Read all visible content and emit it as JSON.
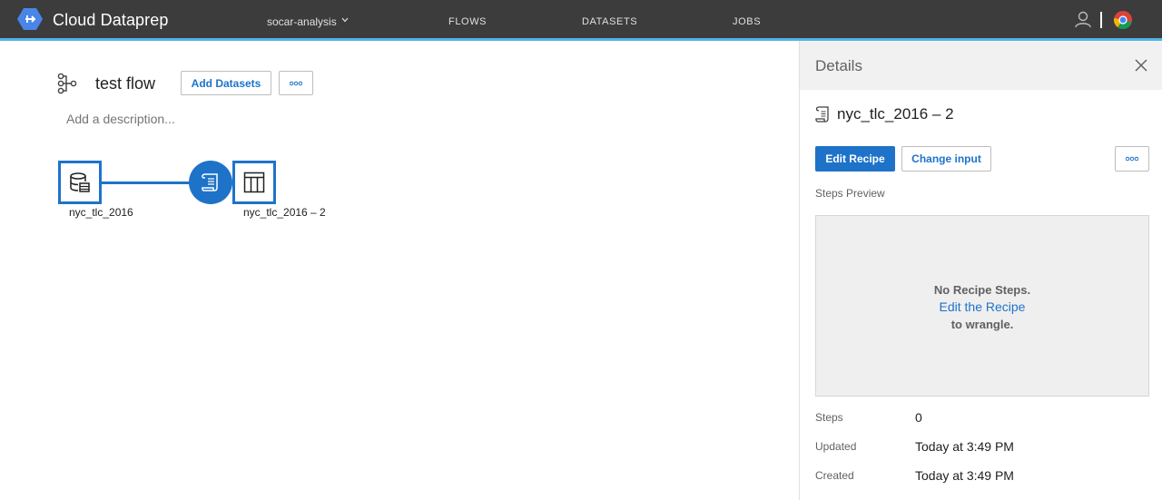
{
  "header": {
    "app_title": "Cloud Dataprep",
    "logo_icon": "dataprep-hexagon-icon",
    "project": "socar-analysis",
    "nav": [
      "FLOWS",
      "DATASETS",
      "JOBS"
    ],
    "user_icon": "user-icon",
    "apps_icon": "chrome-icon"
  },
  "flow": {
    "title": "test flow",
    "add_datasets_label": "Add Datasets",
    "description_placeholder": "Add a description...",
    "nodes": {
      "dataset_label": "nyc_tlc_2016",
      "output_label": "nyc_tlc_2016 – 2"
    }
  },
  "details": {
    "panel_title": "Details",
    "recipe_title": "nyc_tlc_2016 – 2",
    "edit_recipe_label": "Edit Recipe",
    "change_input_label": "Change input",
    "steps_preview_label": "Steps Preview",
    "empty": {
      "line1": "No Recipe Steps.",
      "link": "Edit the Recipe",
      "line3": "to wrangle."
    },
    "meta": {
      "steps_label": "Steps",
      "steps_value": "0",
      "updated_label": "Updated",
      "updated_value": "Today at 3:49 PM",
      "created_label": "Created",
      "created_value": "Today at 3:49 PM"
    }
  },
  "colors": {
    "topbar": "#3c3c3c",
    "accent": "#1e73c9",
    "topbar_underline": "#4fb3e8"
  }
}
